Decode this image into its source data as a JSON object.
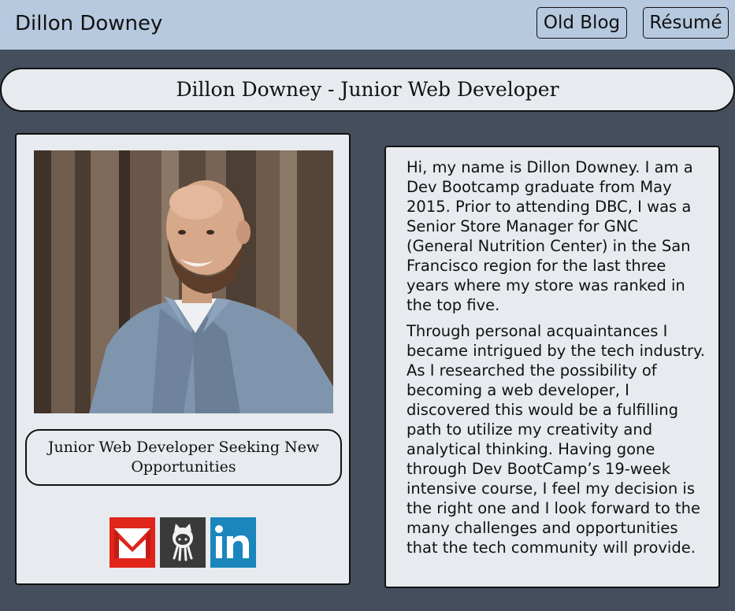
{
  "header": {
    "brand": "Dillon Downey",
    "nav": {
      "old_blog": "Old Blog",
      "resume": "Résumé"
    }
  },
  "page": {
    "title": "Dillon Downey - Junior Web Developer"
  },
  "profile": {
    "photo_icon": "profile-photo",
    "tagline": "Junior Web Developer Seeking New Opportunities",
    "socials": [
      {
        "name": "gmail-icon",
        "color": "#e0251b"
      },
      {
        "name": "github-icon",
        "color": "#3a3a3a"
      },
      {
        "name": "linkedin-icon",
        "color": "#1b86bc"
      }
    ]
  },
  "bio": {
    "paragraph_1": "Hi, my name is Dillon Downey. I am a Dev Bootcamp graduate from May 2015. Prior to attending DBC, I was a Senior Store Manager for GNC (General Nutrition Center) in the San Francisco region for the last three years where my store was ranked in the top five.",
    "paragraph_2": "Through personal acquaintances I became intrigued by the tech industry. As I researched the possibility of becoming a web developer, I discovered this would be a fulfilling path to utilize my creativity and analytical thinking. Having gone through Dev BootCamp’s 19-week intensive course, I feel my decision is the right one and I look forward to the many challenges and opportunities that the tech community will provide."
  },
  "colors": {
    "header_bg": "#b6c9df",
    "page_bg": "#444e5d",
    "card_bg": "#e7ebef"
  }
}
